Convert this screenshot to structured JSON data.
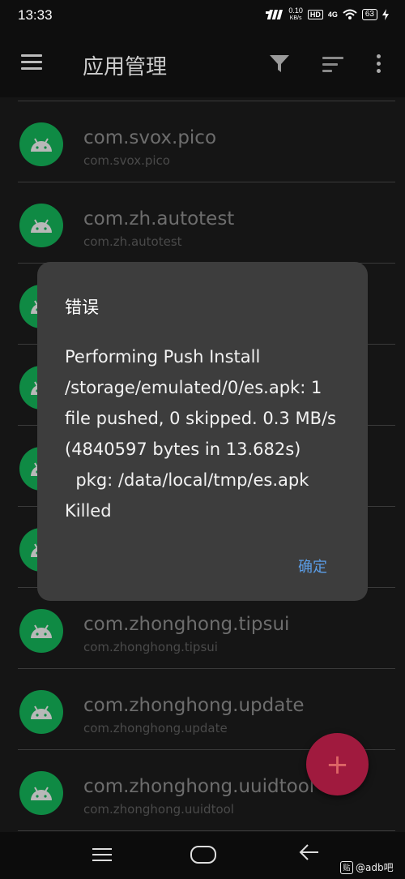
{
  "status_bar": {
    "time": "13:33",
    "speed_value": "0.10",
    "speed_unit": "KB/s",
    "hd": "HD",
    "network": "4G",
    "battery": "63"
  },
  "app_bar": {
    "title": "应用管理"
  },
  "apps": [
    {
      "name": "com.svox.pico",
      "package": "com.svox.pico"
    },
    {
      "name": "com.zh.autotest",
      "package": "com.zh.autotest"
    },
    {
      "name": "",
      "package": ""
    },
    {
      "name": "",
      "package": ""
    },
    {
      "name": "",
      "package": ""
    },
    {
      "name": "",
      "package": ""
    },
    {
      "name": "com.zhonghong.tipsui",
      "package": "com.zhonghong.tipsui"
    },
    {
      "name": "com.zhonghong.update",
      "package": "com.zhonghong.update"
    },
    {
      "name": "com.zhonghong.uuidtool",
      "package": "com.zhonghong.uuidtool"
    }
  ],
  "dialog": {
    "title": "错误",
    "message": "Performing Push Install\n/storage/emulated/0/es.apk: 1\nfile pushed, 0 skipped. 0.3 MB/s\n(4840597 bytes in 13.682s)\n  pkg: /data/local/tmp/es.apk\nKilled",
    "ok_label": "确定"
  },
  "fab": {
    "label": "+"
  },
  "watermark": {
    "badge": "贴",
    "text": "@adb吧"
  },
  "colors": {
    "accent": "#5b9de6",
    "fab": "#a01a3e",
    "app_icon": "#0f8a44"
  }
}
